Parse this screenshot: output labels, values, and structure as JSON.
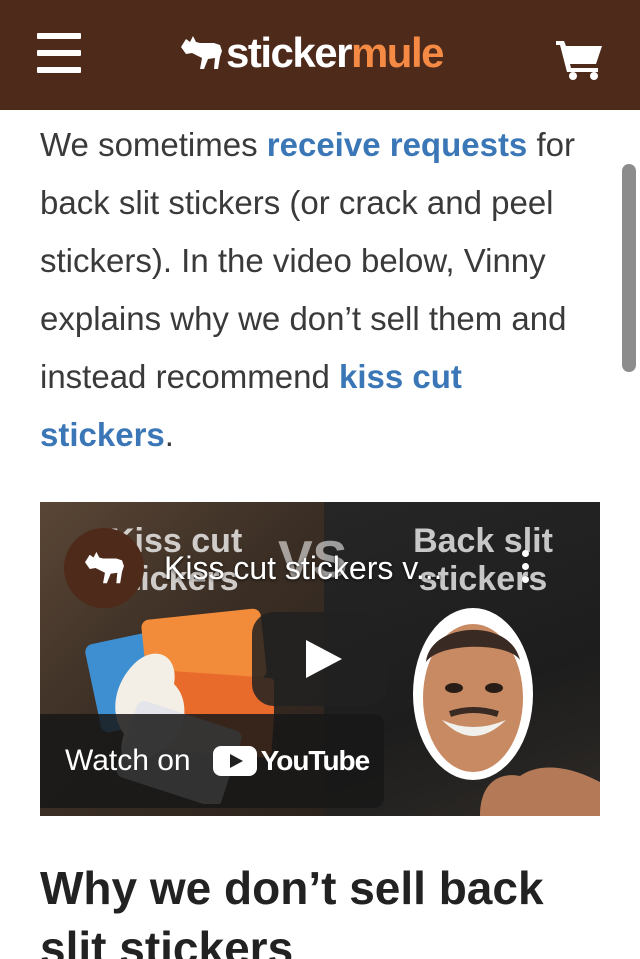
{
  "header": {
    "logo_word_1": "sticker",
    "logo_word_2": "mule",
    "brand_color": "#4e2a1a",
    "accent_color": "#f48a44",
    "icons": [
      "hamburger-menu-icon",
      "mule-icon",
      "shopping-cart-icon"
    ]
  },
  "article": {
    "intro_part1": "We sometimes ",
    "link_receive_requests": "receive requests",
    "intro_part2": " for back slit stickers (or crack and peel stickers). In the video below, Vinny explains why we don’t sell them and instead recommend ",
    "link_kiss_cut": "kiss cut stickers",
    "intro_end": ".",
    "link_color": "#3b77b7",
    "heading": "Why we don’t sell back slit stickers"
  },
  "video": {
    "title": "Kiss cut stickers v...",
    "thumb_left_title": "Kiss cut stickers",
    "thumb_vs": "VS",
    "thumb_right_title": "Back slit stickers",
    "watch_label": "Watch on",
    "youtube_word": "YouTube",
    "youtube_red": "#ff0000"
  }
}
